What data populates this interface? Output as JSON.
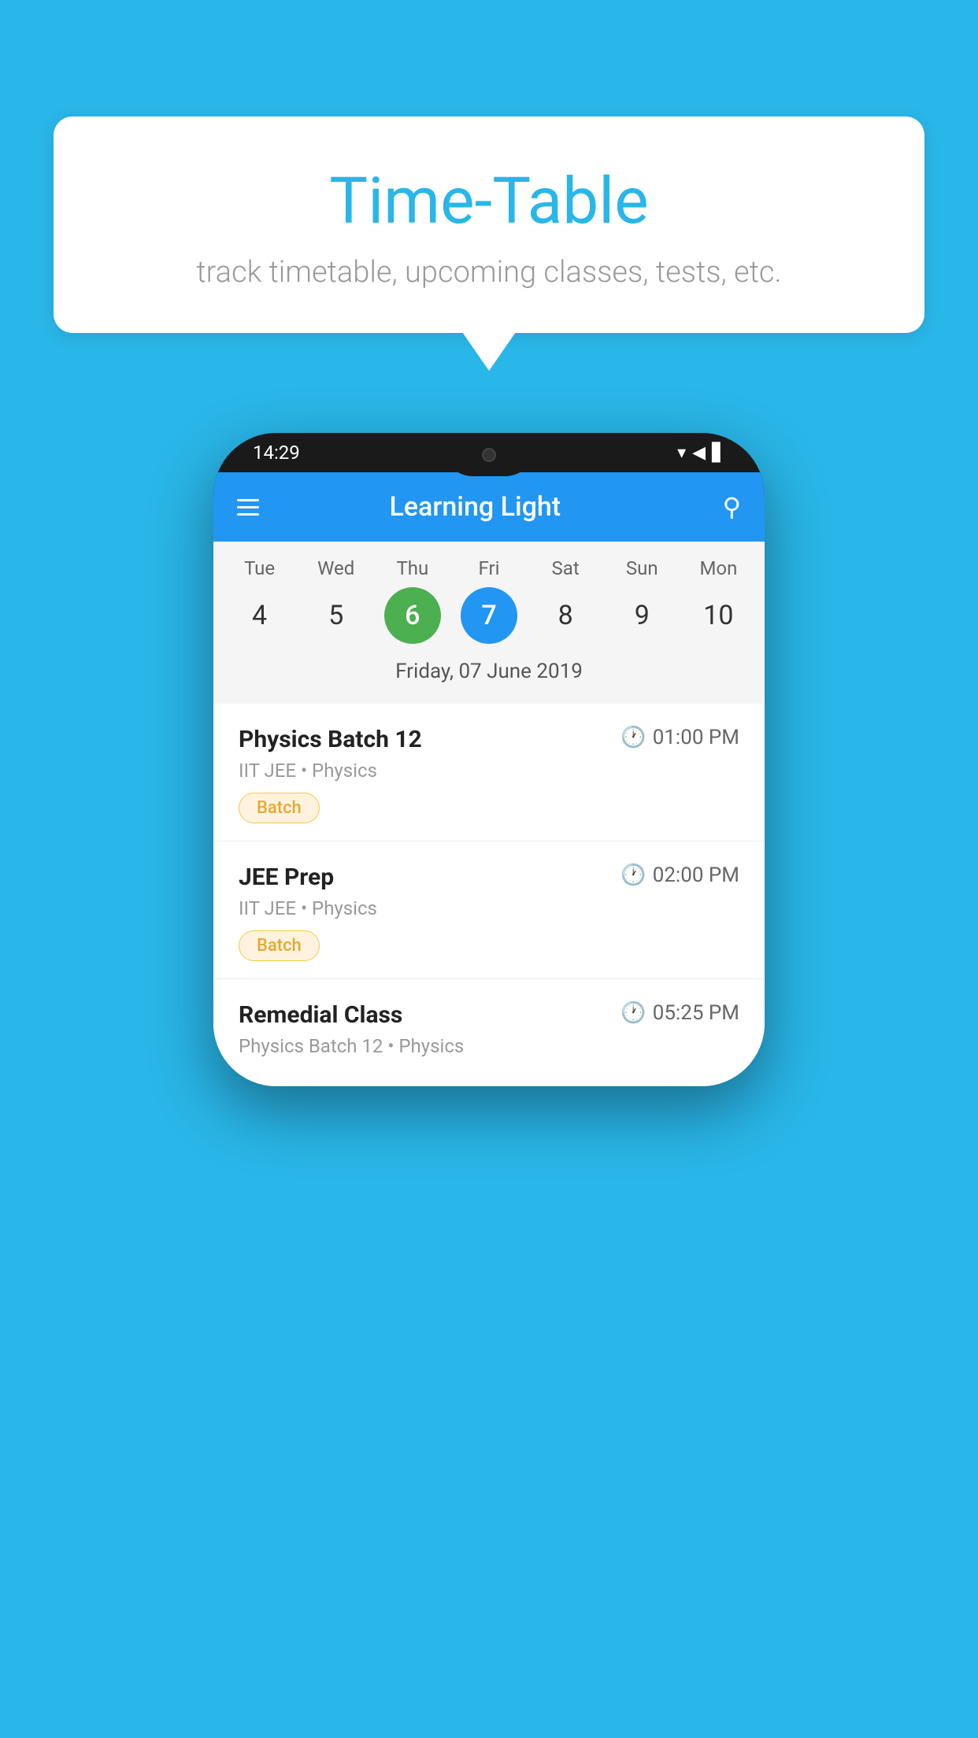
{
  "background_color": "#29b6e8",
  "speech_bubble": {
    "title": "Time-Table",
    "subtitle": "track timetable, upcoming classes, tests, etc."
  },
  "phone": {
    "status_bar": {
      "time": "14:29"
    },
    "app_header": {
      "title": "Learning Light"
    },
    "calendar": {
      "days": [
        {
          "label": "Tue",
          "number": "4"
        },
        {
          "label": "Wed",
          "number": "5"
        },
        {
          "label": "Thu",
          "number": "6",
          "state": "today"
        },
        {
          "label": "Fri",
          "number": "7",
          "state": "selected"
        },
        {
          "label": "Sat",
          "number": "8"
        },
        {
          "label": "Sun",
          "number": "9"
        },
        {
          "label": "Mon",
          "number": "10"
        }
      ],
      "selected_date": "Friday, 07 June 2019"
    },
    "classes": [
      {
        "name": "Physics Batch 12",
        "time": "01:00 PM",
        "subtitle": "IIT JEE • Physics",
        "tag": "Batch"
      },
      {
        "name": "JEE Prep",
        "time": "02:00 PM",
        "subtitle": "IIT JEE • Physics",
        "tag": "Batch"
      },
      {
        "name": "Remedial Class",
        "time": "05:25 PM",
        "subtitle": "Physics Batch 12 • Physics",
        "tag": ""
      }
    ]
  }
}
